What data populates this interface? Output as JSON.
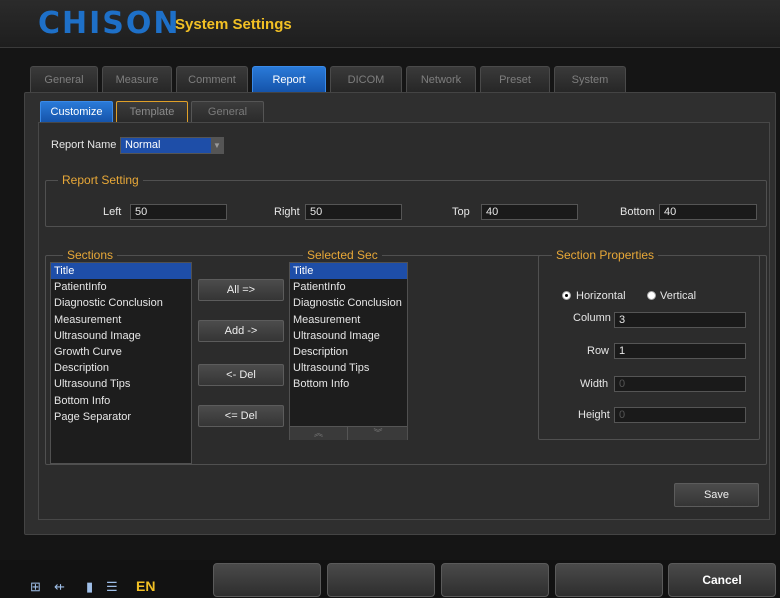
{
  "app": {
    "brand": "CHISON",
    "title": "System Settings"
  },
  "tabs": [
    "General",
    "Measure",
    "Comment",
    "Report",
    "DICOM",
    "Network",
    "Preset",
    "System"
  ],
  "active_tab": "Report",
  "subtabs": [
    "Customize",
    "Template",
    "General"
  ],
  "active_subtab": "Customize",
  "report_name": {
    "label": "Report Name",
    "value": "Normal"
  },
  "report_setting": {
    "title": "Report Setting",
    "left_label": "Left",
    "left_value": "50",
    "right_label": "Right",
    "right_value": "50",
    "top_label": "Top",
    "top_value": "40",
    "bottom_label": "Bottom",
    "bottom_value": "40"
  },
  "sections": {
    "title": "Sections",
    "items": [
      "Title",
      "PatientInfo",
      "Diagnostic Conclusion",
      "Measurement",
      "Ultrasound Image",
      "Growth Curve",
      "Description",
      "Ultrasound Tips",
      "Bottom Info",
      "Page Separator"
    ],
    "selected": "Title"
  },
  "selected_sections": {
    "title": "Selected Sec",
    "items": [
      "Title",
      "PatientInfo",
      "Diagnostic Conclusion",
      "Measurement",
      "Ultrasound Image",
      "Description",
      "Ultrasound Tips",
      "Bottom Info"
    ],
    "selected": "Title"
  },
  "move_buttons": {
    "all": "All =>",
    "add": "Add ->",
    "del": "<- Del",
    "del_all": "<= Del"
  },
  "scroll": {
    "up_icon": "double-chevron-up-icon",
    "down_icon": "double-chevron-down-icon"
  },
  "section_properties": {
    "title": "Section Properties",
    "orientation_horizontal": "Horizontal",
    "orientation_vertical": "Vertical",
    "orientation_selected": "Horizontal",
    "column_label": "Column",
    "column_value": "3",
    "row_label": "Row",
    "row_value": "1",
    "width_label": "Width",
    "width_value": "0",
    "height_label": "Height",
    "height_value": "0"
  },
  "save_label": "Save",
  "status_icons": [
    "network-icon",
    "usb-icon",
    "storage-icon",
    "printer-icon"
  ],
  "language": "EN",
  "softkeys": [
    "",
    "",
    "",
    "",
    "Cancel"
  ],
  "colors": {
    "accent_blue": "#1e4ea8",
    "tab_active": "#2a7ad8",
    "title_yellow": "#f2c024",
    "group_title_orange": "#e8a838"
  }
}
